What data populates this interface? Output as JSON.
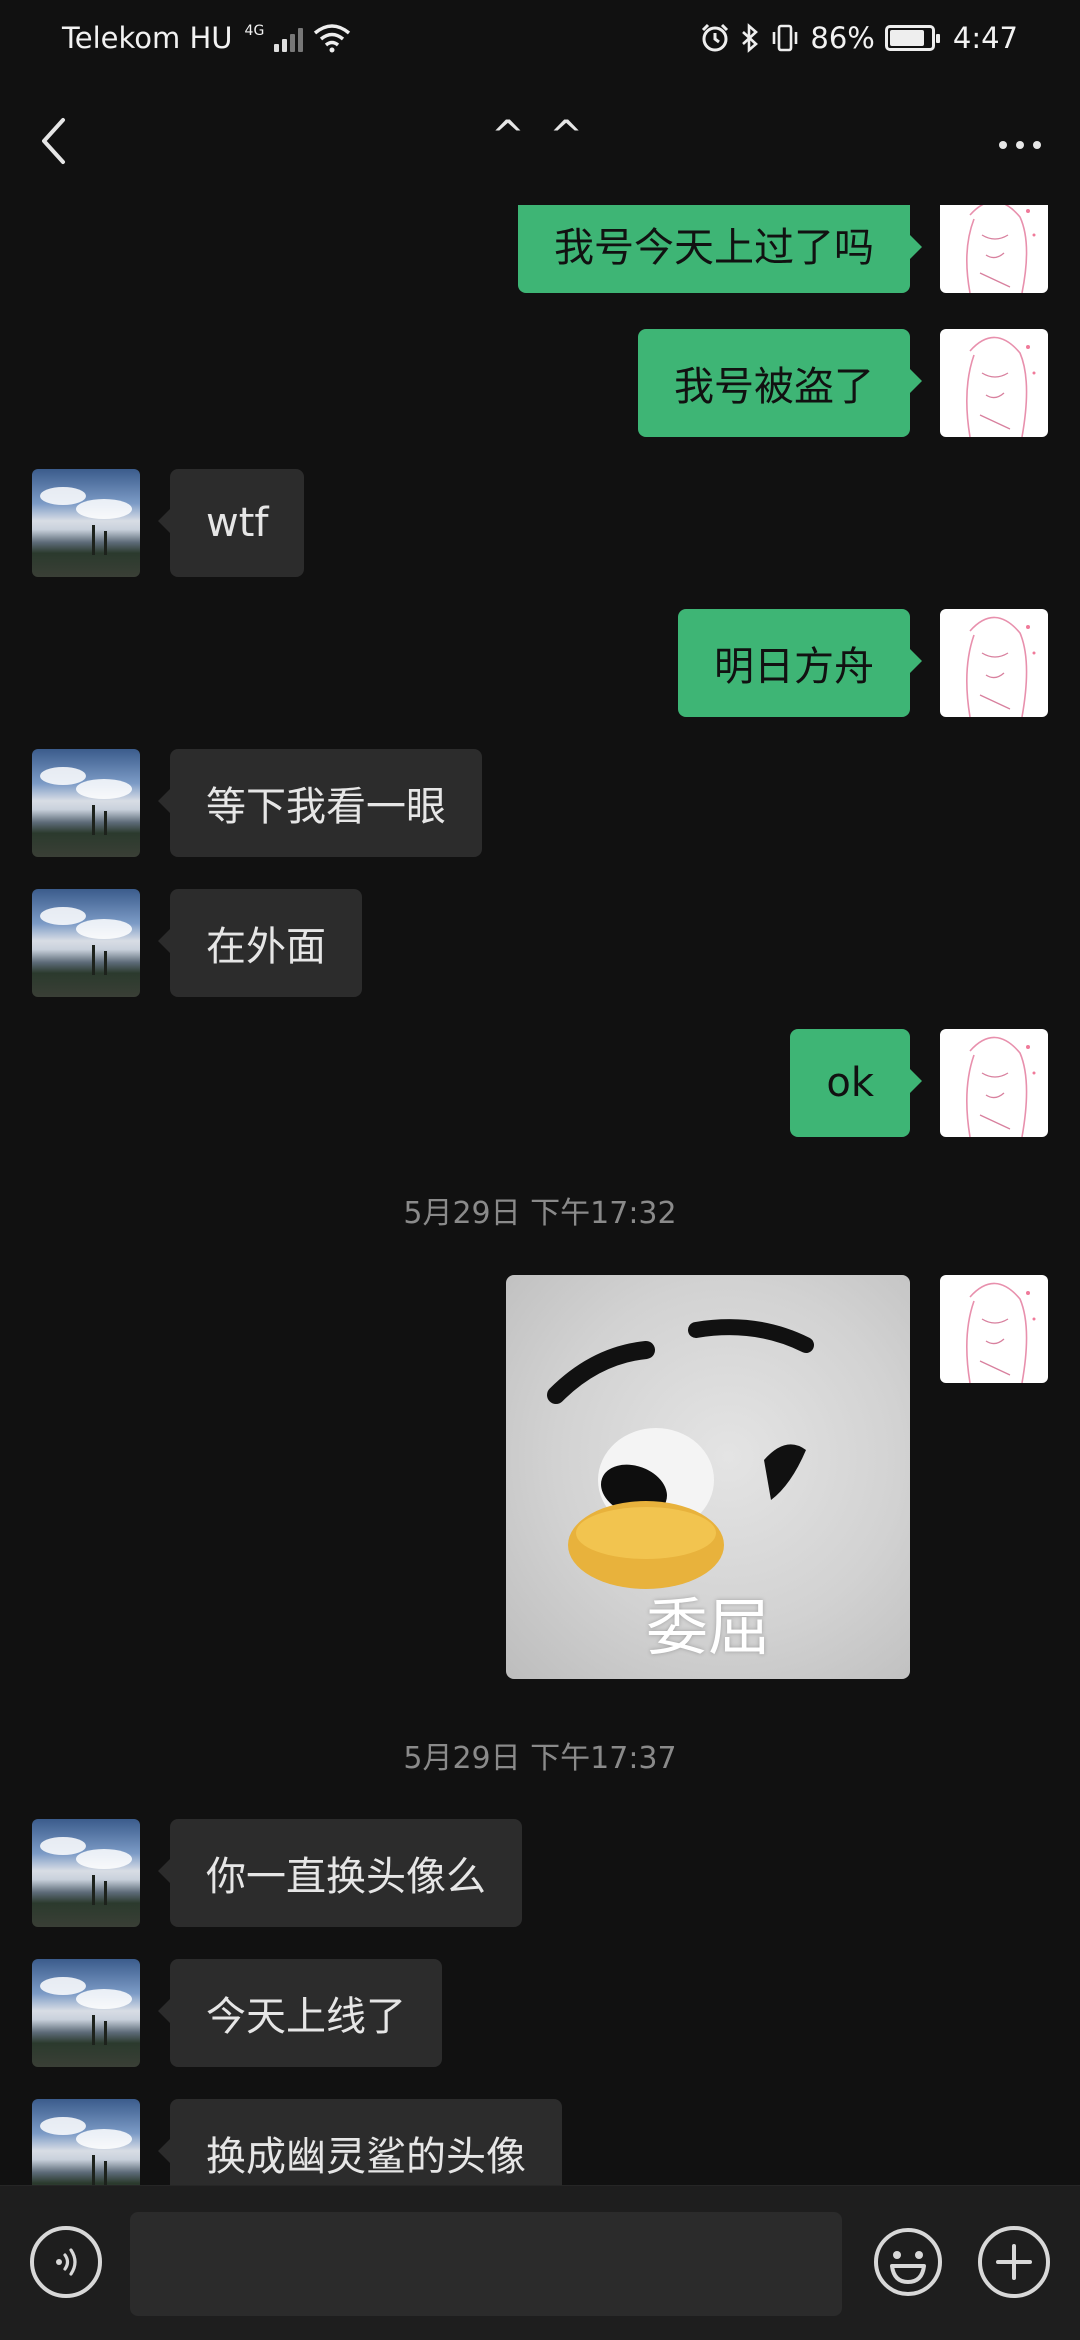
{
  "status_bar": {
    "carrier": "Telekom HU",
    "network_type": "4G",
    "battery_percent": "86%",
    "battery_level": 0.86,
    "time": "4:47",
    "icons": [
      "signal-icon",
      "wifi-icon",
      "alarm-icon",
      "bluetooth-icon",
      "vibrate-icon",
      "battery-icon"
    ]
  },
  "header": {
    "back_icon": "chevron-left-icon",
    "title": "^ ^",
    "more_icon": "more-dots-icon"
  },
  "messages": [
    {
      "side": "out",
      "text": "我号今天上过了吗"
    },
    {
      "side": "out",
      "text": "我号被盗了"
    },
    {
      "side": "in",
      "text": "wtf"
    },
    {
      "side": "out",
      "text": "明日方舟"
    },
    {
      "side": "in",
      "text": "等下我看一眼"
    },
    {
      "side": "in",
      "text": "在外面"
    },
    {
      "side": "out",
      "text": "ok"
    },
    {
      "type": "timestamp",
      "text": "5月29日 下午17:32"
    },
    {
      "side": "out",
      "type": "sticker",
      "caption": "委屈"
    },
    {
      "type": "timestamp",
      "text": "5月29日 下午17:37"
    },
    {
      "side": "in",
      "text": "你一直换头像么"
    },
    {
      "side": "in",
      "text": "今天上线了"
    },
    {
      "side": "in",
      "text": "换成幽灵鲨的头像"
    }
  ],
  "input_bar": {
    "voice_icon": "voice-icon",
    "input_value": "",
    "emoji_icon": "emoji-icon",
    "plus_icon": "plus-icon"
  },
  "colors": {
    "background": "#111111",
    "outgoing_bubble": "#3eb575",
    "incoming_bubble": "#2c2c2c",
    "timestamp_text": "#8a8a8a"
  }
}
